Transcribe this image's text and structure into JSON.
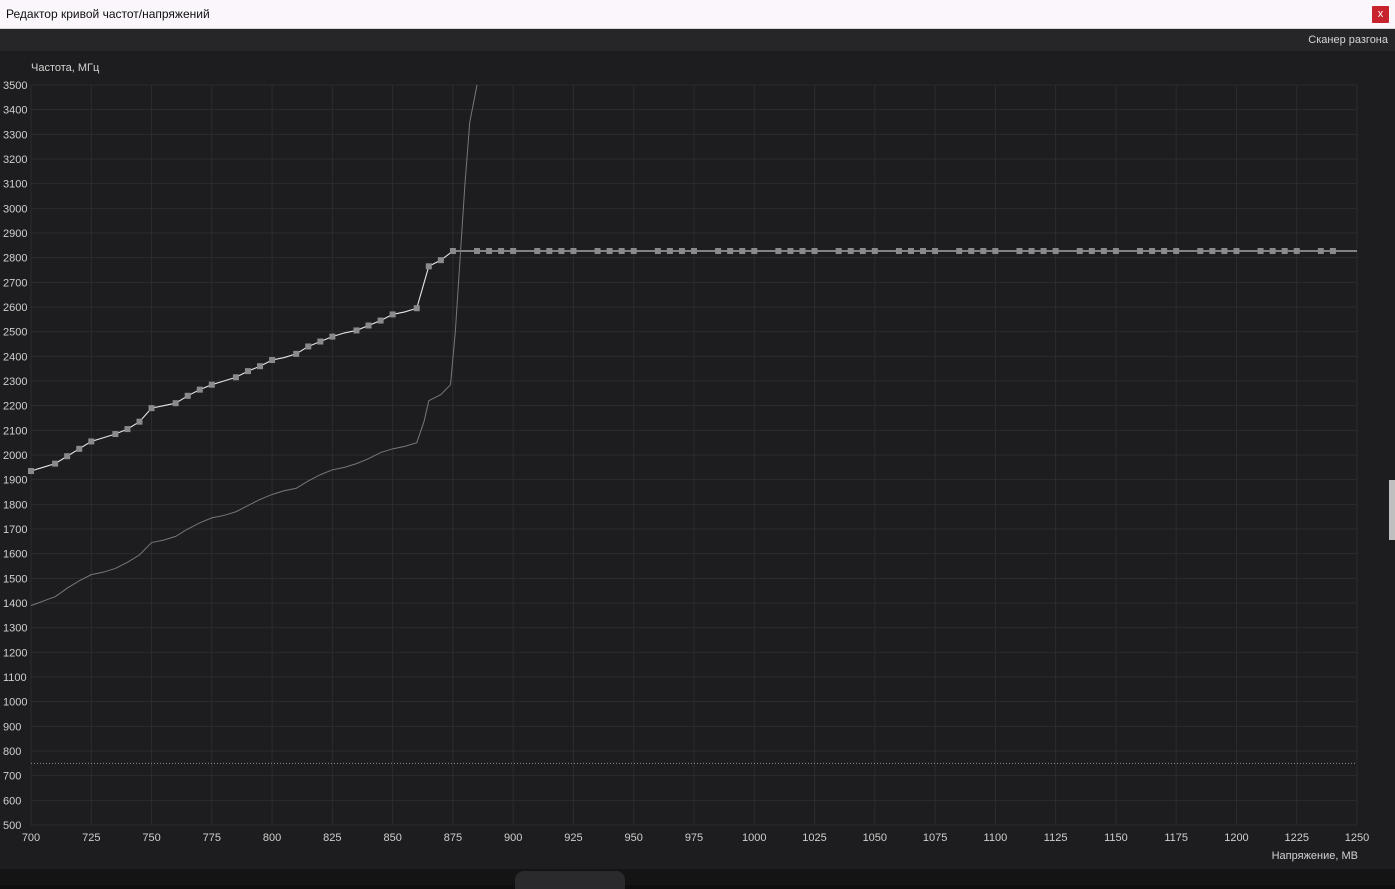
{
  "window": {
    "title": "Редактор кривой частот/напряжений",
    "close_label": "x"
  },
  "toolbar": {
    "scanner_label": "Сканер разгона"
  },
  "colors": {
    "background": "#1d1d1f",
    "grid": "#2c2c30",
    "curve": "#e6e6e6",
    "base_curve": "#77777b",
    "point": "#8a8a8c",
    "limit_line": "#8d8d8d",
    "close_button": "#c8222c"
  },
  "chart_data": {
    "type": "line",
    "xlabel": "Напряжение, МВ",
    "ylabel": "Частота, МГц",
    "xlim": [
      700,
      1250
    ],
    "ylim": [
      500,
      3500
    ],
    "x_ticks": [
      700,
      725,
      750,
      775,
      800,
      825,
      850,
      875,
      900,
      925,
      950,
      975,
      1000,
      1025,
      1050,
      1075,
      1100,
      1125,
      1150,
      1175,
      1200,
      1225,
      1250
    ],
    "y_ticks": [
      500,
      600,
      700,
      800,
      900,
      1000,
      1100,
      1200,
      1300,
      1400,
      1500,
      1600,
      1700,
      1800,
      1900,
      2000,
      2100,
      2200,
      2300,
      2400,
      2500,
      2600,
      2700,
      2800,
      2900,
      3000,
      3100,
      3200,
      3300,
      3400,
      3500
    ],
    "grid": true,
    "limit_line": {
      "y": 750,
      "style": "dotted"
    },
    "series": [
      {
        "role": "edited-curve",
        "has_points": true,
        "x": [
          700,
          705,
          710,
          715,
          720,
          725,
          730,
          735,
          740,
          745,
          750,
          755,
          760,
          765,
          770,
          775,
          780,
          785,
          790,
          795,
          800,
          805,
          810,
          815,
          820,
          825,
          830,
          835,
          840,
          845,
          850,
          855,
          860,
          865,
          870,
          875,
          880,
          885,
          890,
          895,
          900,
          905,
          910,
          915,
          920,
          925,
          930,
          935,
          940,
          945,
          950,
          955,
          960,
          965,
          970,
          975,
          980,
          985,
          990,
          995,
          1000,
          1005,
          1010,
          1015,
          1020,
          1025,
          1030,
          1035,
          1040,
          1045,
          1050,
          1055,
          1060,
          1065,
          1070,
          1075,
          1080,
          1085,
          1090,
          1095,
          1100,
          1105,
          1110,
          1115,
          1120,
          1125,
          1130,
          1135,
          1140,
          1145,
          1150,
          1155,
          1160,
          1165,
          1170,
          1175,
          1180,
          1185,
          1190,
          1195,
          1200,
          1205,
          1210,
          1215,
          1220,
          1225,
          1230,
          1235,
          1240,
          1245,
          1250
        ],
        "y": [
          1935,
          1950,
          1965,
          1995,
          2025,
          2055,
          2070,
          2085,
          2105,
          2135,
          2190,
          2200,
          2210,
          2240,
          2265,
          2285,
          2300,
          2315,
          2340,
          2360,
          2385,
          2395,
          2410,
          2440,
          2460,
          2480,
          2495,
          2505,
          2525,
          2545,
          2570,
          2580,
          2595,
          2765,
          2790,
          2827,
          2827,
          2827,
          2827,
          2827,
          2827,
          2827,
          2827,
          2827,
          2827,
          2827,
          2827,
          2827,
          2827,
          2827,
          2827,
          2827,
          2827,
          2827,
          2827,
          2827,
          2827,
          2827,
          2827,
          2827,
          2827,
          2827,
          2827,
          2827,
          2827,
          2827,
          2827,
          2827,
          2827,
          2827,
          2827,
          2827,
          2827,
          2827,
          2827,
          2827,
          2827,
          2827,
          2827,
          2827,
          2827,
          2827,
          2827,
          2827,
          2827,
          2827,
          2827,
          2827,
          2827,
          2827,
          2827,
          2827,
          2827,
          2827,
          2827,
          2827,
          2827,
          2827,
          2827,
          2827,
          2827,
          2827,
          2827,
          2827,
          2827,
          2827,
          2827,
          2827,
          2827,
          2827,
          2827
        ],
        "marker_x": [
          700,
          710,
          715,
          720,
          725,
          735,
          740,
          745,
          750,
          760,
          765,
          770,
          775,
          785,
          790,
          795,
          800,
          810,
          815,
          820,
          825,
          835,
          840,
          845,
          850,
          860,
          865,
          870,
          875,
          885,
          890,
          895,
          900,
          910,
          915,
          920,
          925,
          935,
          940,
          945,
          950,
          960,
          965,
          970,
          975,
          985,
          990,
          995,
          1000,
          1010,
          1015,
          1020,
          1025,
          1035,
          1040,
          1045,
          1050,
          1060,
          1065,
          1070,
          1075,
          1085,
          1090,
          1095,
          1100,
          1110,
          1115,
          1120,
          1125,
          1135,
          1140,
          1145,
          1150,
          1160,
          1165,
          1170,
          1175,
          1185,
          1190,
          1195,
          1200,
          1210,
          1215,
          1220,
          1225,
          1235,
          1240
        ]
      },
      {
        "role": "base-curve",
        "has_points": false,
        "x": [
          700,
          703,
          707,
          710,
          715,
          720,
          725,
          730,
          735,
          740,
          745,
          750,
          755,
          760,
          765,
          770,
          775,
          780,
          785,
          790,
          795,
          800,
          805,
          810,
          815,
          820,
          825,
          830,
          835,
          840,
          845,
          850,
          855,
          860,
          863,
          865,
          870,
          874,
          876,
          878,
          880,
          882,
          885
        ],
        "y": [
          1390,
          1400,
          1415,
          1425,
          1460,
          1490,
          1515,
          1525,
          1540,
          1565,
          1595,
          1645,
          1655,
          1670,
          1700,
          1725,
          1745,
          1755,
          1770,
          1795,
          1820,
          1840,
          1855,
          1865,
          1895,
          1920,
          1940,
          1950,
          1965,
          1985,
          2010,
          2025,
          2035,
          2050,
          2135,
          2220,
          2245,
          2285,
          2500,
          2800,
          3100,
          3350,
          3500
        ]
      }
    ]
  }
}
